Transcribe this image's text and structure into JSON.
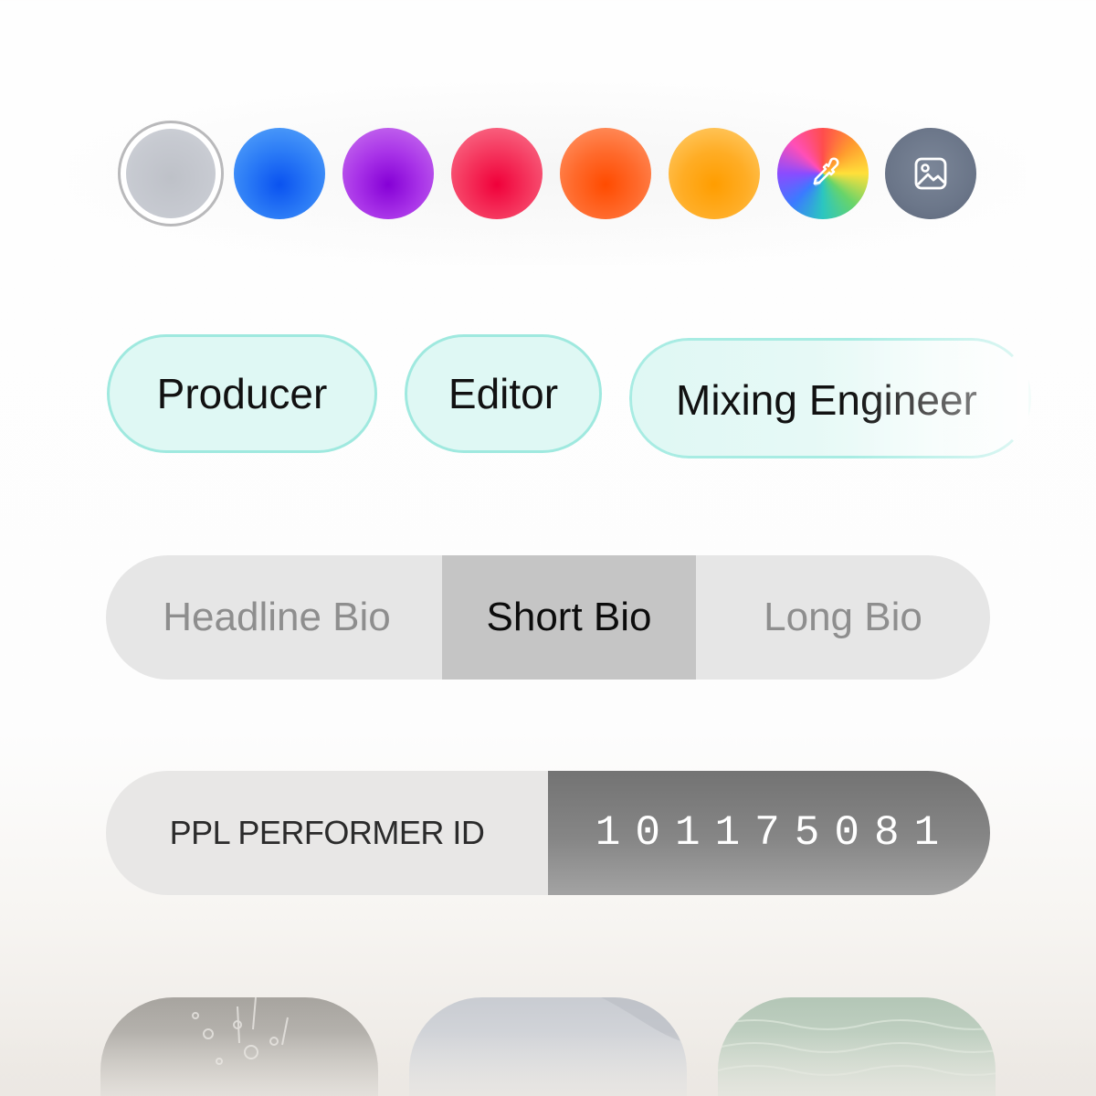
{
  "color_swatches": [
    {
      "name": "Gray",
      "color": "#c4c7cd",
      "selected": true
    },
    {
      "name": "Blue",
      "color": "#2b7bf6",
      "selected": false
    },
    {
      "name": "Purple",
      "color": "#a934e8",
      "selected": false
    },
    {
      "name": "Red",
      "color": "#f5365e",
      "selected": false
    },
    {
      "name": "Orange",
      "color": "#ff6a2c",
      "selected": false
    },
    {
      "name": "Yellow",
      "color": "#ffad25",
      "selected": false
    },
    {
      "name": "Custom",
      "icon": "eyedropper-icon",
      "selected": false
    },
    {
      "name": "Image",
      "icon": "image-icon",
      "color": "#6b7689",
      "selected": false
    }
  ],
  "roles": [
    "Producer",
    "Editor",
    "Mixing Engineer"
  ],
  "bio_tabs": {
    "items": [
      "Headline Bio",
      "Short Bio",
      "Long Bio"
    ],
    "selected": "Short Bio"
  },
  "performer_id": {
    "label": "PPL PERFORMER ID",
    "value": "101175081"
  },
  "background_thumbnails": [
    "water-splash-image",
    "sky-image",
    "sea-image"
  ],
  "colors": {
    "chip_fill": "#dff8f4",
    "chip_border": "#9fe9df",
    "segment_selected": "#c5c5c5",
    "id_value_bg": "#868686"
  }
}
